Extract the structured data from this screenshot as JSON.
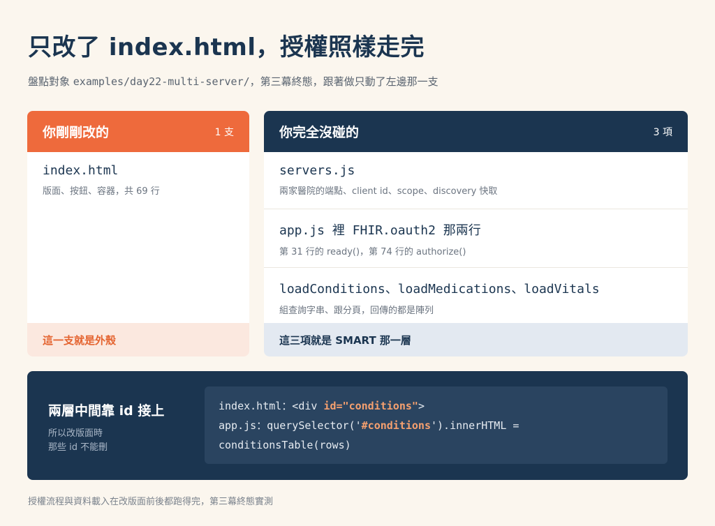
{
  "header": {
    "title": "只改了 index.html，授權照樣走完",
    "subtitle_prefix": "盤點對象 ",
    "subtitle_path": "examples/day22-multi-server/",
    "subtitle_suffix": "，第三幕終態，跟著做只動了左邊那一支"
  },
  "left_card": {
    "title": "你剛剛改的",
    "count": "1 支",
    "items": [
      {
        "name": "index.html",
        "desc": "版面、按鈕、容器，共 69 行"
      }
    ],
    "footer": "這一支就是外殼"
  },
  "right_card": {
    "title": "你完全沒碰的",
    "count": "3 項",
    "items": [
      {
        "name": "servers.js",
        "desc": "兩家醫院的端點、client id、scope、discovery 快取"
      },
      {
        "name": "app.js 裡 FHIR.oauth2 那兩行",
        "desc": "第 31 行的 ready()，第 74 行的 authorize()"
      },
      {
        "name": "loadConditions、loadMedications、loadVitals",
        "desc": "組查詢字串、跟分頁，回傳的都是陣列"
      }
    ],
    "footer": "這三項就是 SMART 那一層"
  },
  "bottom": {
    "title": "兩層中間靠 id 接上",
    "note_line1": "所以改版面時",
    "note_line2": "那些 id 不能刪",
    "code": {
      "line1_a": "index.html：<div ",
      "line1_hl": "id=\"conditions\"",
      "line1_b": ">",
      "line2_a": "app.js：querySelector('",
      "line2_hl": "#conditions",
      "line2_b": "').innerHTML =",
      "line3": "conditionsTable(rows)"
    }
  },
  "footnote": "授權流程與資料載入在改版面前後都跑得完，第三幕終態實測",
  "colors": {
    "background": "#fbf6ee",
    "navy": "#1b3550",
    "orange": "#ee6a3c",
    "orange_light": "#fbe8df",
    "blue_light": "#e3e9f1",
    "code_bg": "#2a4460",
    "code_highlight": "#f5a06f"
  }
}
